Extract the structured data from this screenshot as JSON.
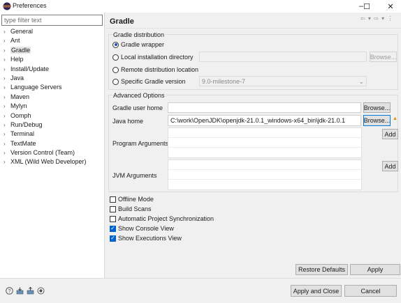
{
  "window": {
    "title": "Preferences",
    "controls": {
      "minimize": "–",
      "maximize": "☐",
      "close": "✕"
    }
  },
  "filter": {
    "placeholder": "type filter text"
  },
  "tree": {
    "items": [
      {
        "label": "General",
        "selected": false
      },
      {
        "label": "Ant",
        "selected": false
      },
      {
        "label": "Gradle",
        "selected": true
      },
      {
        "label": "Help",
        "selected": false
      },
      {
        "label": "Install/Update",
        "selected": false
      },
      {
        "label": "Java",
        "selected": false
      },
      {
        "label": "Language Servers",
        "selected": false
      },
      {
        "label": "Maven",
        "selected": false
      },
      {
        "label": "Mylyn",
        "selected": false
      },
      {
        "label": "Oomph",
        "selected": false
      },
      {
        "label": "Run/Debug",
        "selected": false
      },
      {
        "label": "Terminal",
        "selected": false
      },
      {
        "label": "TextMate",
        "selected": false
      },
      {
        "label": "Version Control (Team)",
        "selected": false
      },
      {
        "label": "XML (Wild Web Developer)",
        "selected": false
      }
    ]
  },
  "page": {
    "title": "Gradle",
    "nav_glyphs": "⇦ ▾ ⇨ ▾ ⋮"
  },
  "distribution": {
    "title": "Gradle distribution",
    "options": {
      "wrapper": "Gradle wrapper",
      "local": "Local installation directory",
      "remote": "Remote distribution location",
      "specific": "Specific Gradle version"
    },
    "selected": "wrapper",
    "local_value": "",
    "browse_label": "Browse...",
    "version_value": "9.0-milestone-7"
  },
  "advanced": {
    "title": "Advanced Options",
    "user_home_label": "Gradle user home",
    "user_home_value": "",
    "java_home_label": "Java home",
    "java_home_value": "C:\\work\\OpenJDK\\openjdk-21.0.1_windows-x64_bin\\jdk-21.0.1",
    "browse_label": "Browse...",
    "warning_glyph": "▲",
    "program_args_label": "Program Arguments",
    "jvm_args_label": "JVM Arguments",
    "add_label": "Add"
  },
  "checkboxes": [
    {
      "label": "Offline Mode",
      "checked": false
    },
    {
      "label": "Build Scans",
      "checked": false
    },
    {
      "label": "Automatic Project Synchronization",
      "checked": false
    },
    {
      "label": "Show Console View",
      "checked": true
    },
    {
      "label": "Show Executions View",
      "checked": true
    }
  ],
  "buttons": {
    "restore_defaults": "Restore Defaults",
    "apply": "Apply",
    "apply_close": "Apply and Close",
    "cancel": "Cancel"
  },
  "status_icons": [
    "help-icon",
    "import-icon",
    "export-icon",
    "record-icon"
  ],
  "colors": {
    "accent": "#0062cc",
    "warning": "#e08a00"
  }
}
